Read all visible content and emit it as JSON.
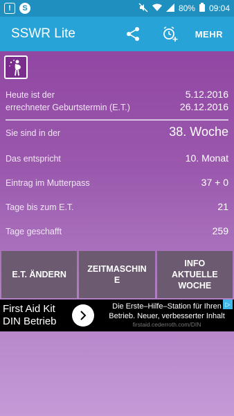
{
  "status_bar": {
    "battery": "80%",
    "time": "09:04",
    "icons": [
      "notification-icon",
      "sync-icon",
      "mute-icon",
      "wifi-icon",
      "signal-icon",
      "battery-icon"
    ]
  },
  "app_bar": {
    "title": "SSWR Lite",
    "share_icon": "share-icon",
    "alarm_icon": "alarm-add-icon",
    "more_label": "MEHR"
  },
  "info": {
    "today_label": "Heute ist der",
    "today_value": "5.12.2016",
    "due_label": "errechneter Geburtstermin (E.T.)",
    "due_value": "26.12.2016",
    "week_label": "Sie sind in der",
    "week_value": "38. Woche",
    "month_label": "Das entspricht",
    "month_value": "10. Monat",
    "passport_label": "Eintrag im Mutterpass",
    "passport_value": "37 + 0",
    "days_left_label": "Tage bis zum E.T.",
    "days_left_value": "21",
    "days_done_label": "Tage geschafft",
    "days_done_value": "259"
  },
  "buttons": {
    "change_due": "E.T. ÄNDERN",
    "time_machine": "ZEITMASCHIN\nE",
    "info_week": "INFO\nAKTUELLE\nWOCHE"
  },
  "ad": {
    "title_line1": "First Aid Kit",
    "title_line2": "DIN Betrieb",
    "text": "Die Erste–Hilfe–Station für Ihren Betrieb. Neuer, verbesserter Inhalt",
    "url": "firstaid.cederroth.com/DIN"
  },
  "colors": {
    "app_bar": "#27a3d8",
    "status_bar": "#1f8fbf",
    "background_top": "#8e3f9e",
    "background_bottom": "#c59ad6",
    "button_bg": "#6c5a70"
  }
}
